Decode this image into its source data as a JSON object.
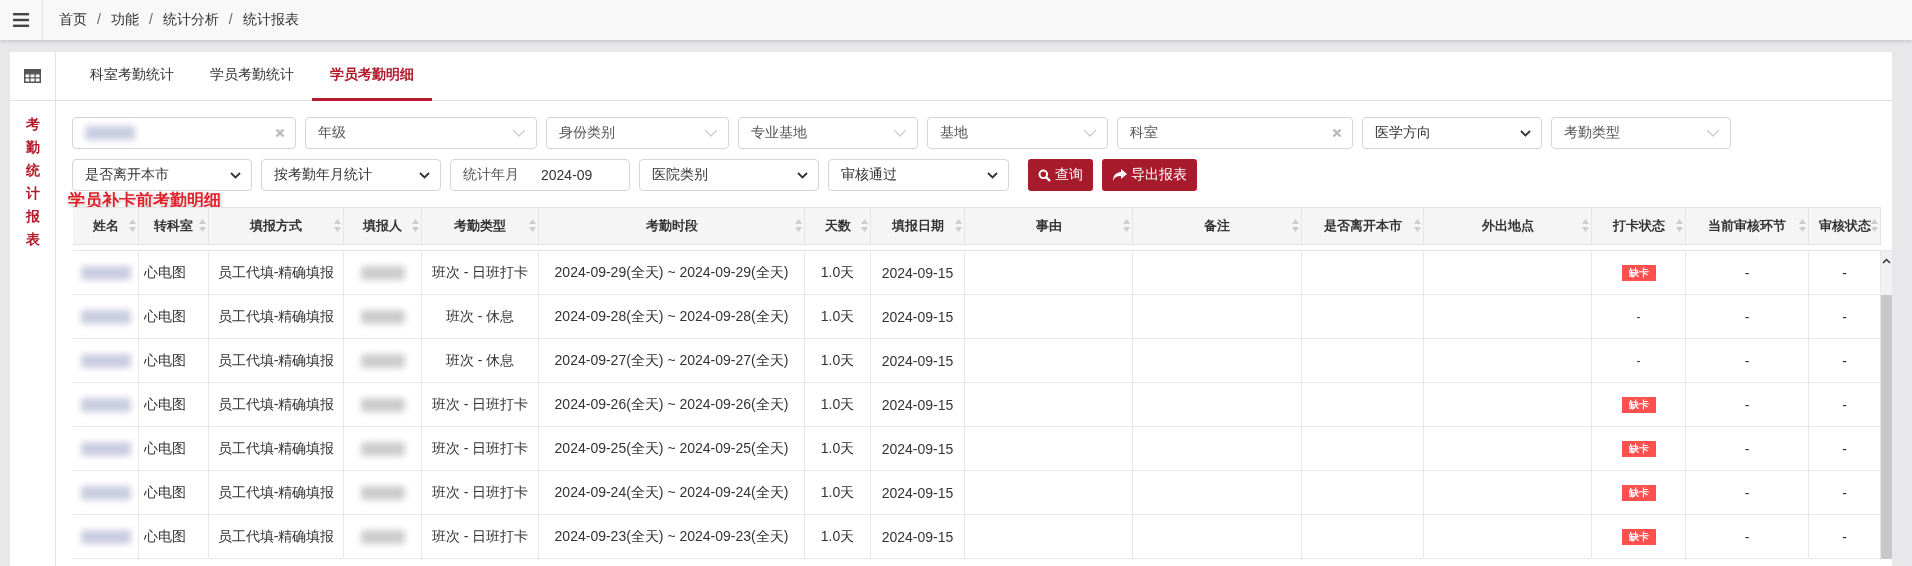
{
  "breadcrumb": {
    "items": [
      "首页",
      "功能",
      "统计分析",
      "统计报表"
    ],
    "separator": "/"
  },
  "side_label": "考勤统计报表",
  "tabs": [
    {
      "label": "科室考勤统计",
      "selected": false
    },
    {
      "label": "学员考勤统计",
      "selected": false
    },
    {
      "label": "学员考勤明细",
      "selected": true
    }
  ],
  "filter_rows": [
    [
      {
        "kind": "clearable",
        "redacted": true
      },
      {
        "kind": "select-light",
        "placeholder": "年级"
      },
      {
        "kind": "select-light",
        "placeholder": "身份类别"
      },
      {
        "kind": "select-light",
        "placeholder": "专业基地"
      },
      {
        "kind": "select-light",
        "placeholder": "基地"
      },
      {
        "kind": "clearable",
        "placeholder": "科室"
      },
      {
        "kind": "select",
        "value": "医学方向"
      },
      {
        "kind": "select-light",
        "placeholder": "考勤类型"
      }
    ],
    [
      {
        "kind": "select",
        "value": "是否离开本市"
      },
      {
        "kind": "select",
        "value": "按考勤年月统计"
      },
      {
        "kind": "labeled",
        "label": "统计年月",
        "value": "2024-09"
      },
      {
        "kind": "select",
        "value": "医院类别"
      },
      {
        "kind": "select",
        "value": "审核通过"
      }
    ]
  ],
  "buttons": [
    {
      "kind": "search",
      "label": "查询"
    },
    {
      "kind": "export",
      "label": "导出报表"
    }
  ],
  "annotation": "学员补卡前考勤明细",
  "table": {
    "columns": [
      "姓名",
      "转科室",
      "填报方式",
      "填报人",
      "考勤类型",
      "考勤时段",
      "天数",
      "填报日期",
      "事由",
      "备注",
      "是否离开本市",
      "外出地点",
      "打卡状态",
      "当前审核环节",
      "审核状态"
    ],
    "rows": [
      {
        "department": "心电图",
        "method": "员工代填-精确填报",
        "type": "班次 - 日班打卡",
        "period": "2024-09-29(全天) ~ 2024-09-29(全天)",
        "days": "1.0天",
        "date": "2024-09-15",
        "punch": {
          "kind": "badge",
          "text": "缺卡"
        },
        "stage": "-",
        "review": "-"
      },
      {
        "department": "心电图",
        "method": "员工代填-精确填报",
        "type": "班次 - 休息",
        "period": "2024-09-28(全天) ~ 2024-09-28(全天)",
        "days": "1.0天",
        "date": "2024-09-15",
        "punch": {
          "kind": "plain",
          "text": "-"
        },
        "stage": "-",
        "review": "-"
      },
      {
        "department": "心电图",
        "method": "员工代填-精确填报",
        "type": "班次 - 休息",
        "period": "2024-09-27(全天) ~ 2024-09-27(全天)",
        "days": "1.0天",
        "date": "2024-09-15",
        "punch": {
          "kind": "plain",
          "text": "-"
        },
        "stage": "-",
        "review": "-"
      },
      {
        "department": "心电图",
        "method": "员工代填-精确填报",
        "type": "班次 - 日班打卡",
        "period": "2024-09-26(全天) ~ 2024-09-26(全天)",
        "days": "1.0天",
        "date": "2024-09-15",
        "punch": {
          "kind": "badge",
          "text": "缺卡"
        },
        "stage": "-",
        "review": "-"
      },
      {
        "department": "心电图",
        "method": "员工代填-精确填报",
        "type": "班次 - 日班打卡",
        "period": "2024-09-25(全天) ~ 2024-09-25(全天)",
        "days": "1.0天",
        "date": "2024-09-15",
        "punch": {
          "kind": "badge",
          "text": "缺卡"
        },
        "stage": "-",
        "review": "-"
      },
      {
        "department": "心电图",
        "method": "员工代填-精确填报",
        "type": "班次 - 日班打卡",
        "period": "2024-09-24(全天) ~ 2024-09-24(全天)",
        "days": "1.0天",
        "date": "2024-09-15",
        "punch": {
          "kind": "badge",
          "text": "缺卡"
        },
        "stage": "-",
        "review": "-"
      },
      {
        "department": "心电图",
        "method": "员工代填-精确填报",
        "type": "班次 - 日班打卡",
        "period": "2024-09-23(全天) ~ 2024-09-23(全天)",
        "days": "1.0天",
        "date": "2024-09-15",
        "punch": {
          "kind": "badge",
          "text": "缺卡"
        },
        "stage": "-",
        "review": "-"
      }
    ]
  }
}
